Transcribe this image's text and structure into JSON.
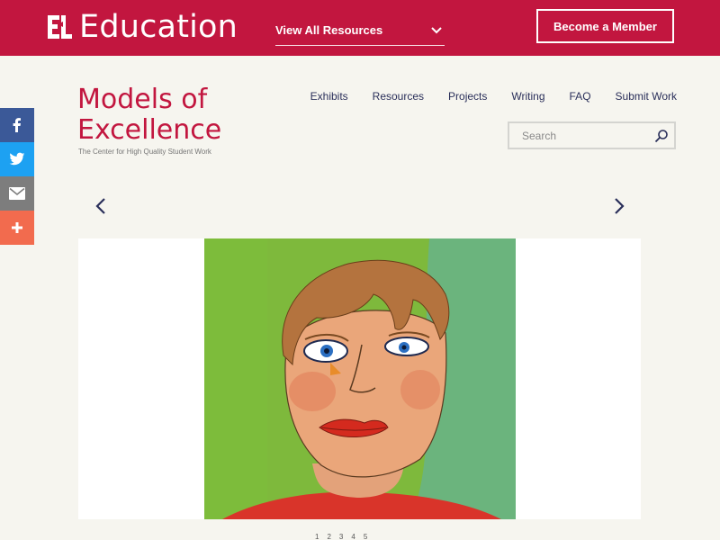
{
  "brand": {
    "logo_mark": "EL",
    "name": "Education"
  },
  "header": {
    "view_all_label": "View All Resources",
    "member_button": "Become a Member"
  },
  "site": {
    "title_line1": "Models of",
    "title_line2": "Excellence",
    "tagline": "The Center for High Quality Student Work"
  },
  "nav": {
    "items": [
      "Exhibits",
      "Resources",
      "Projects",
      "Writing",
      "FAQ",
      "Submit Work"
    ]
  },
  "search": {
    "placeholder": "Search"
  },
  "share": {
    "icons": [
      "facebook-icon",
      "twitter-icon",
      "email-icon",
      "plus-icon"
    ]
  },
  "carousel": {
    "slide_dots": [
      "1",
      "2",
      "3",
      "4",
      "5"
    ]
  },
  "colors": {
    "brand": "#c2163f",
    "nav_text": "#2a2f5a",
    "background": "#f6f5ef"
  }
}
